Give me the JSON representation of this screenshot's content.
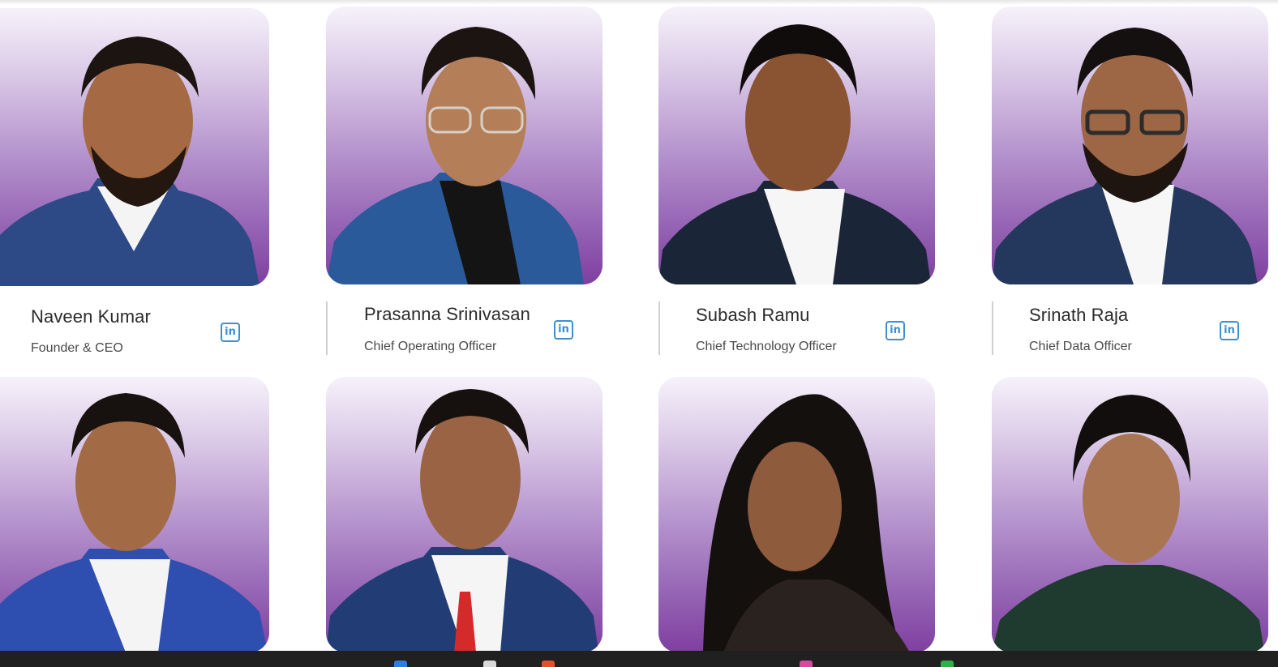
{
  "team": {
    "members": [
      {
        "name": "Naveen Kumar",
        "role": "Founder & CEO",
        "social": "linkedin-icon"
      },
      {
        "name": "Prasanna Srinivasan",
        "role": "Chief Operating Officer",
        "social": "linkedin-icon"
      },
      {
        "name": "Subash Ramu",
        "role": "Chief Technology Officer",
        "social": "linkedin-icon"
      },
      {
        "name": "Srinath Raja",
        "role": "Chief Data Officer",
        "social": "linkedin-icon"
      }
    ]
  },
  "icons": {
    "linkedin_glyph": "in"
  },
  "colors": {
    "photo_gradient_top": "#f6f2fa",
    "photo_gradient_bottom": "#7f3fa0",
    "linkedin_blue": "#3d8fd1",
    "taskbar": "#202020"
  }
}
